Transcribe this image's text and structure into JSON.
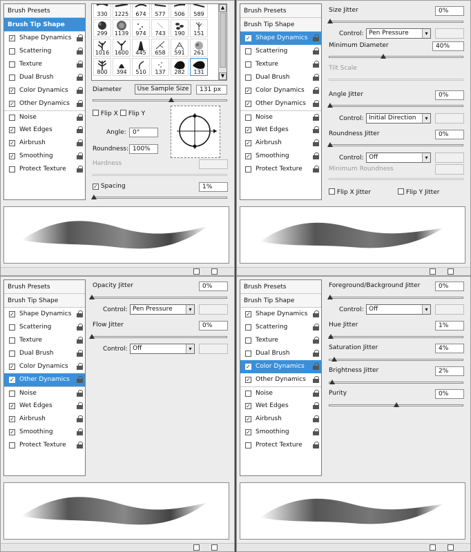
{
  "menu": {
    "presets": "Brush Presets",
    "tip": "Brush Tip Shape",
    "items": [
      "Shape Dynamics",
      "Scattering",
      "Texture",
      "Dual Brush",
      "Color Dynamics",
      "Other Dynamics",
      "Noise",
      "Wet Edges",
      "Airbrush",
      "Smoothing",
      "Protect Texture"
    ],
    "check_mark": "✓"
  },
  "tip": {
    "grid": [
      [
        "330",
        "1225",
        "674",
        "577",
        "506",
        "589"
      ],
      [
        "299",
        "1139",
        "974",
        "743",
        "190",
        "151"
      ],
      [
        "1016",
        "1600",
        "445",
        "658",
        "591",
        "261"
      ],
      [
        "800",
        "394",
        "510",
        "137",
        "282",
        "131"
      ]
    ],
    "diameter_label": "Diameter",
    "sample_button": "Use Sample Size",
    "diameter_value": "131 px",
    "flip_x": "Flip X",
    "flip_y": "Flip Y",
    "angle_label": "Angle:",
    "angle_value": "0°",
    "roundness_label": "Roundness:",
    "roundness_value": "100%",
    "hardness_label": "Hardness",
    "spacing_label": "Spacing",
    "spacing_value": "1%"
  },
  "shape": {
    "size_jitter_label": "Size Jitter",
    "size_jitter_value": "0%",
    "control_label": "Control:",
    "size_control": "Pen Pressure",
    "min_diam_label": "Minimum Diameter",
    "min_diam_value": "40%",
    "tilt_label": "Tilt Scale",
    "angle_jitter_label": "Angle Jitter",
    "angle_jitter_value": "0%",
    "angle_control": "Initial Direction",
    "round_jitter_label": "Roundness Jitter",
    "round_jitter_value": "0%",
    "round_control": "Off",
    "min_round_label": "Minimum Roundness",
    "flipx_label": "Flip X Jitter",
    "flipy_label": "Flip Y Jitter"
  },
  "other": {
    "opacity_label": "Opacity Jitter",
    "opacity_value": "0%",
    "control_label": "Control:",
    "opacity_control": "Pen Pressure",
    "flow_label": "Flow Jitter",
    "flow_value": "0%",
    "flow_control": "Off"
  },
  "color": {
    "fgbg_label": "Foreground/Background Jitter",
    "fgbg_value": "0%",
    "control_label": "Control:",
    "fgbg_control": "Off",
    "hue_label": "Hue Jitter",
    "hue_value": "1%",
    "sat_label": "Saturation Jitter",
    "sat_value": "4%",
    "bright_label": "Brightness Jitter",
    "bright_value": "2%",
    "purity_label": "Purity",
    "purity_value": "0%"
  },
  "icons": {
    "new_preset": "new-brush-icon",
    "delete": "trash-icon",
    "lock": "lock-icon"
  },
  "colors": {
    "selection": "#3a8fd8",
    "panel": "#ececec",
    "frame": "#4a4a4a"
  }
}
